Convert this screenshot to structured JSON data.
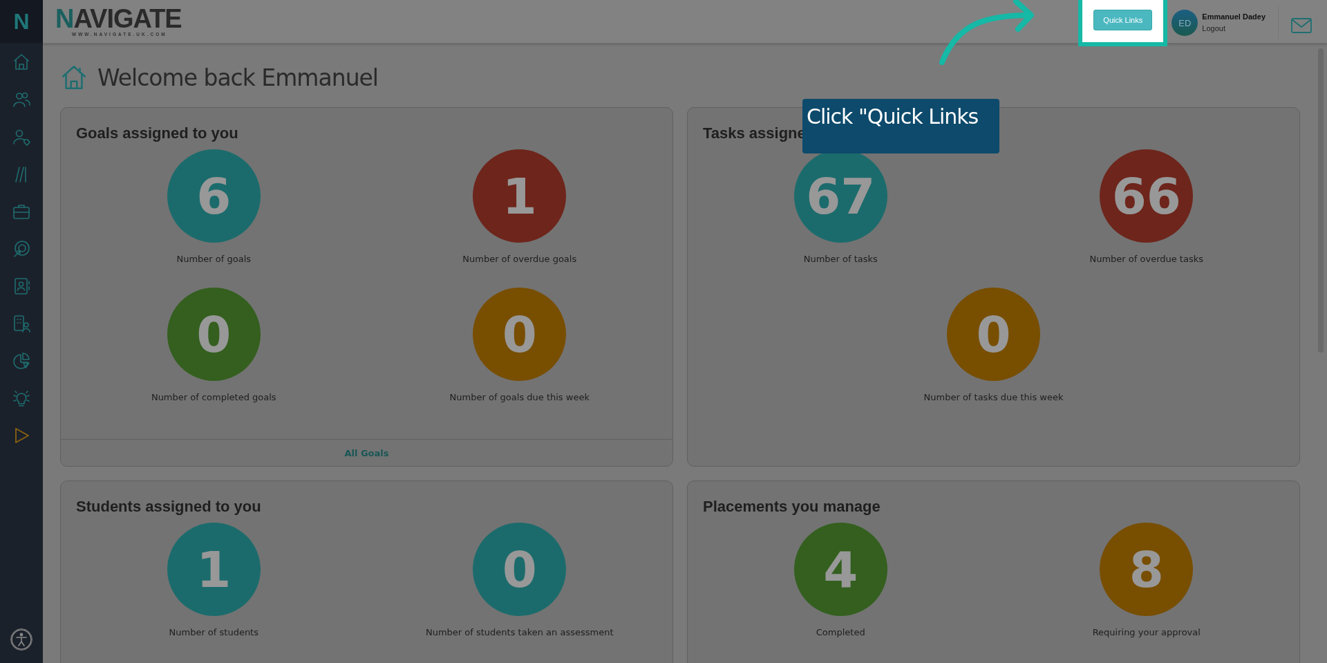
{
  "sidebar": {
    "logo": "N"
  },
  "header": {
    "logo": {
      "initial": "N",
      "rest": "AVIGATE",
      "url": "WWW.NAVIGATE.UK.COM"
    },
    "quick_links": "Quick Links",
    "user": {
      "initials": "ED",
      "name": "Emmanuel Dadey",
      "logout": "Logout"
    }
  },
  "page_title": "Welcome back Emmanuel",
  "cards": [
    {
      "title": "Goals assigned to you",
      "stats": [
        {
          "value": "6",
          "label": "Number of goals",
          "color": "#1f7778"
        },
        {
          "value": "1",
          "label": "Number of overdue goals",
          "color": "#7a291e"
        },
        {
          "value": "0",
          "label": "Number of completed goals",
          "color": "#3a6a22"
        },
        {
          "value": "0",
          "label": "Number of goals due this week",
          "color": "#855700"
        }
      ],
      "footer": "All Goals"
    },
    {
      "title": "Tasks assigne",
      "stats": [
        {
          "value": "67",
          "label": "Number of tasks",
          "color": "#1f7778"
        },
        {
          "value": "66",
          "label": "Number of overdue tasks",
          "color": "#7a291e"
        },
        {
          "value": "0",
          "label": "Number of tasks due this week",
          "color": "#855700"
        }
      ]
    },
    {
      "title": "Students assigned to you",
      "stats": [
        {
          "value": "1",
          "label": "Number of students",
          "color": "#1f7778"
        },
        {
          "value": "0",
          "label": "Number of students taken an assessment",
          "color": "#1f7778"
        }
      ]
    },
    {
      "title": "Placements you manage",
      "stats": [
        {
          "value": "4",
          "label": "Completed",
          "color": "#3a6a22"
        },
        {
          "value": "8",
          "label": "Requiring your approval",
          "color": "#855700"
        }
      ]
    }
  ],
  "tooltip": "Click \"Quick Links"
}
